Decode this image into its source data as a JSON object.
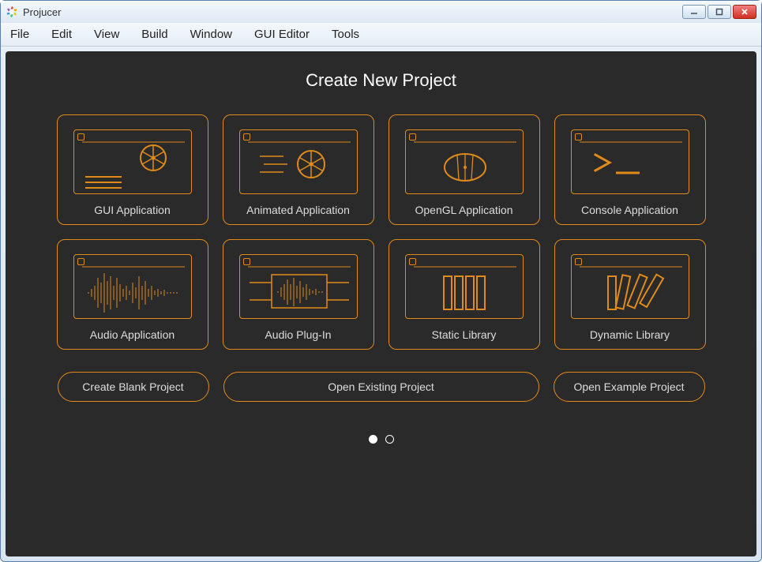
{
  "window": {
    "title": "Projucer"
  },
  "menu": {
    "file": "File",
    "edit": "Edit",
    "view": "View",
    "build": "Build",
    "window": "Window",
    "gui_editor": "GUI Editor",
    "tools": "Tools"
  },
  "page": {
    "heading": "Create New Project"
  },
  "cards": {
    "gui": "GUI Application",
    "animated": "Animated Application",
    "opengl": "OpenGL Application",
    "console": "Console Application",
    "audio": "Audio Application",
    "plugin": "Audio Plug-In",
    "static": "Static Library",
    "dynamic": "Dynamic Library"
  },
  "actions": {
    "blank": "Create Blank Project",
    "open": "Open Existing Project",
    "example": "Open Example Project"
  },
  "colors": {
    "accent": "#e08a1a",
    "background": "#2a2a2a"
  }
}
